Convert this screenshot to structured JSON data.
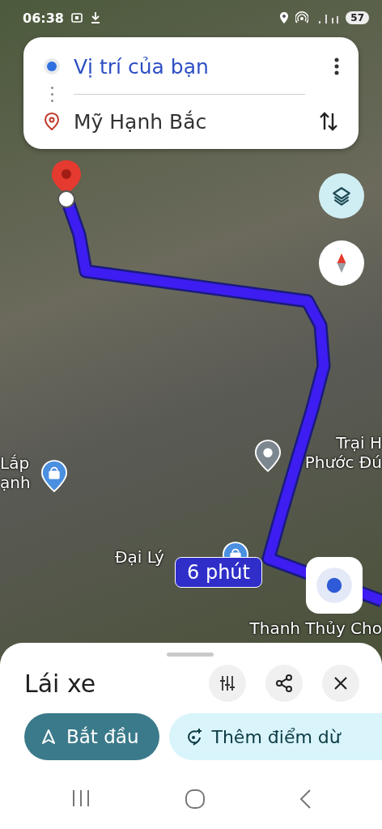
{
  "status_bar": {
    "time": "06:38",
    "battery": "57"
  },
  "route_card": {
    "origin": "Vị trí của bạn",
    "destination": "Mỹ Hạnh Bắc"
  },
  "map_labels": [
    {
      "lines": [
        "Trại H",
        "Phước Đú"
      ]
    },
    {
      "lines": [
        "Lắp",
        "ạnh"
      ]
    },
    {
      "lines": [
        "Đại Lý"
      ]
    },
    {
      "lines": [
        "Thanh Thủy Cho"
      ]
    }
  ],
  "duration_badge": "6 phút",
  "sheet": {
    "title": "Lái xe",
    "start_button": "Bắt đầu",
    "add_stop_button": "Thêm điểm dừ"
  }
}
